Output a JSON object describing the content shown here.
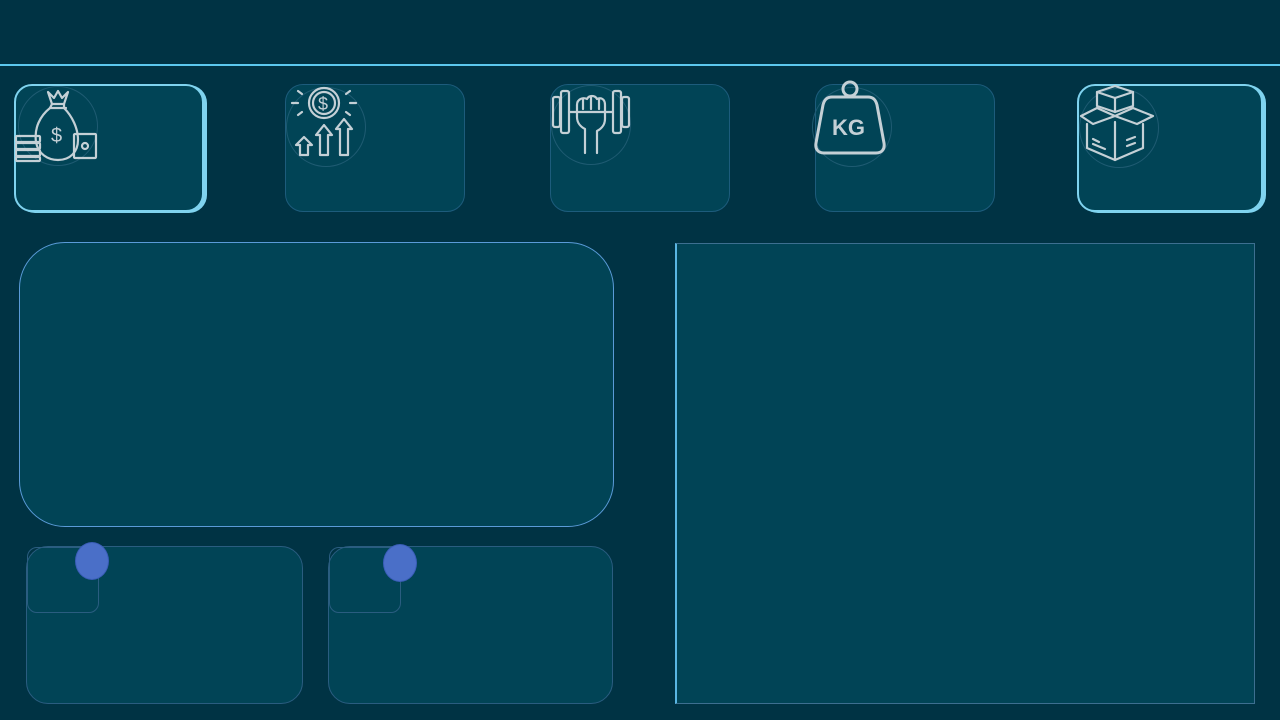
{
  "theme": {
    "background": "#003344",
    "card_fill": "#014456",
    "card_border": "#1d5c7c",
    "accent": "#5cc8ee",
    "icon_stroke": "#c4d0d6",
    "marker": "#4a6fc8"
  },
  "kpi_cards": [
    {
      "icon": "money-bag-icon",
      "active": true
    },
    {
      "icon": "revenue-growth-icon",
      "active": false
    },
    {
      "icon": "dumbbell-strength-icon",
      "active": false
    },
    {
      "icon": "kg-weight-icon",
      "active": false
    },
    {
      "icon": "boxes-icon",
      "active": true
    }
  ],
  "panels": {
    "main_chart": {},
    "side_panel": {},
    "mini_cards": [
      {
        "marker": "marker-dot"
      },
      {
        "marker": "marker-dot"
      }
    ]
  }
}
